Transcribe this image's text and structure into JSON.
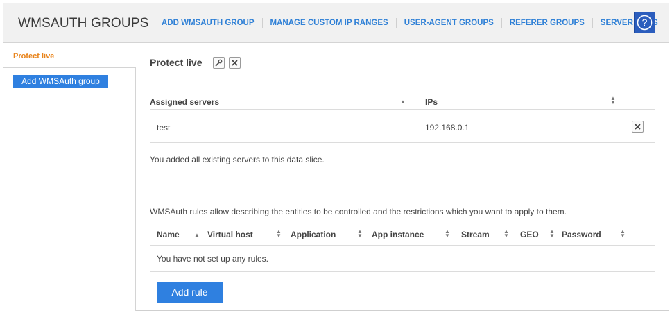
{
  "header": {
    "title": "WMSAUTH GROUPS",
    "nav": [
      "ADD WMSAUTH GROUP",
      "MANAGE CUSTOM IP RANGES",
      "USER-AGENT GROUPS",
      "REFERER GROUPS",
      "SERVER LOGS"
    ],
    "help_label": "?"
  },
  "sidebar": {
    "active_item": "Protect live",
    "add_button": "Add WMSAuth group"
  },
  "group": {
    "title": "Protect live"
  },
  "servers_table": {
    "columns": [
      "Assigned servers",
      "IPs"
    ],
    "rows": [
      {
        "server": "test",
        "ip": "192.168.0.1"
      }
    ],
    "footer_note": "You added all existing servers to this data slice."
  },
  "rules": {
    "description": "WMSAuth rules allow describing the entities to be controlled and the restrictions which you want to apply to them.",
    "columns": [
      "Name",
      "Virtual host",
      "Application",
      "App instance",
      "Stream",
      "GEO",
      "Password"
    ],
    "empty_text": "You have not set up any rules.",
    "add_button": "Add rule"
  },
  "colors": {
    "accent": "#2f80e0",
    "active": "#e8841c",
    "help_bg": "#2b5dbd"
  },
  "icons": {
    "edit": "wrench-icon",
    "delete": "close-icon",
    "help": "question-circle-icon",
    "sort_asc": "sort-asc-icon",
    "sort_both": "sort-both-icon"
  }
}
